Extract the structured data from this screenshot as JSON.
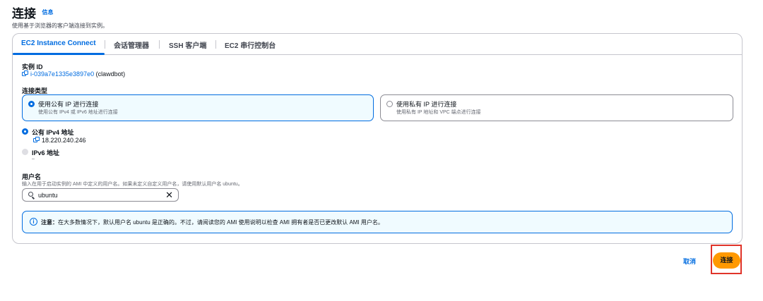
{
  "header": {
    "title": "连接",
    "info_link": "信息",
    "subtitle": "使用基于浏览器的客户端连接到实例。"
  },
  "tabs": [
    "EC2 Instance Connect",
    "会话管理器",
    "SSH 客户端",
    "EC2 串行控制台"
  ],
  "instance": {
    "label": "实例 ID",
    "id": "i-039a7e1335e3897e0",
    "name": "(clawdbot)"
  },
  "connection_type": {
    "label": "连接类型",
    "options": [
      {
        "title": "使用公有 IP 进行连接",
        "desc": "使用公有 IPv4 或 IPv6 地址进行连接",
        "selected": true
      },
      {
        "title": "使用私有 IP 进行连接",
        "desc": "使用私有 IP 地址和 VPC 端点进行连接",
        "selected": false
      }
    ]
  },
  "address": {
    "ipv4_label": "公有 IPv4 地址",
    "ipv4_value": "18.220.240.246",
    "ipv6_label": "IPv6 地址",
    "ipv6_value": "–"
  },
  "username": {
    "label": "用户名",
    "help": "输入在用于启动实例的 AMI 中定义的用户名。如果未定义自定义用户名，请使用默认用户名 ubuntu。",
    "value": "ubuntu"
  },
  "alert": {
    "prefix": "注意：",
    "text": "在大多数情况下，默认用户名 ubuntu 是正确的。不过，请阅读您的 AMI 使用说明以检查 AMI 拥有者是否已更改默认 AMI 用户名。"
  },
  "actions": {
    "cancel": "取消",
    "connect": "连接"
  },
  "colors": {
    "accent": "#006ce0",
    "primary_button": "#ff9900",
    "highlight": "#e0342a"
  }
}
